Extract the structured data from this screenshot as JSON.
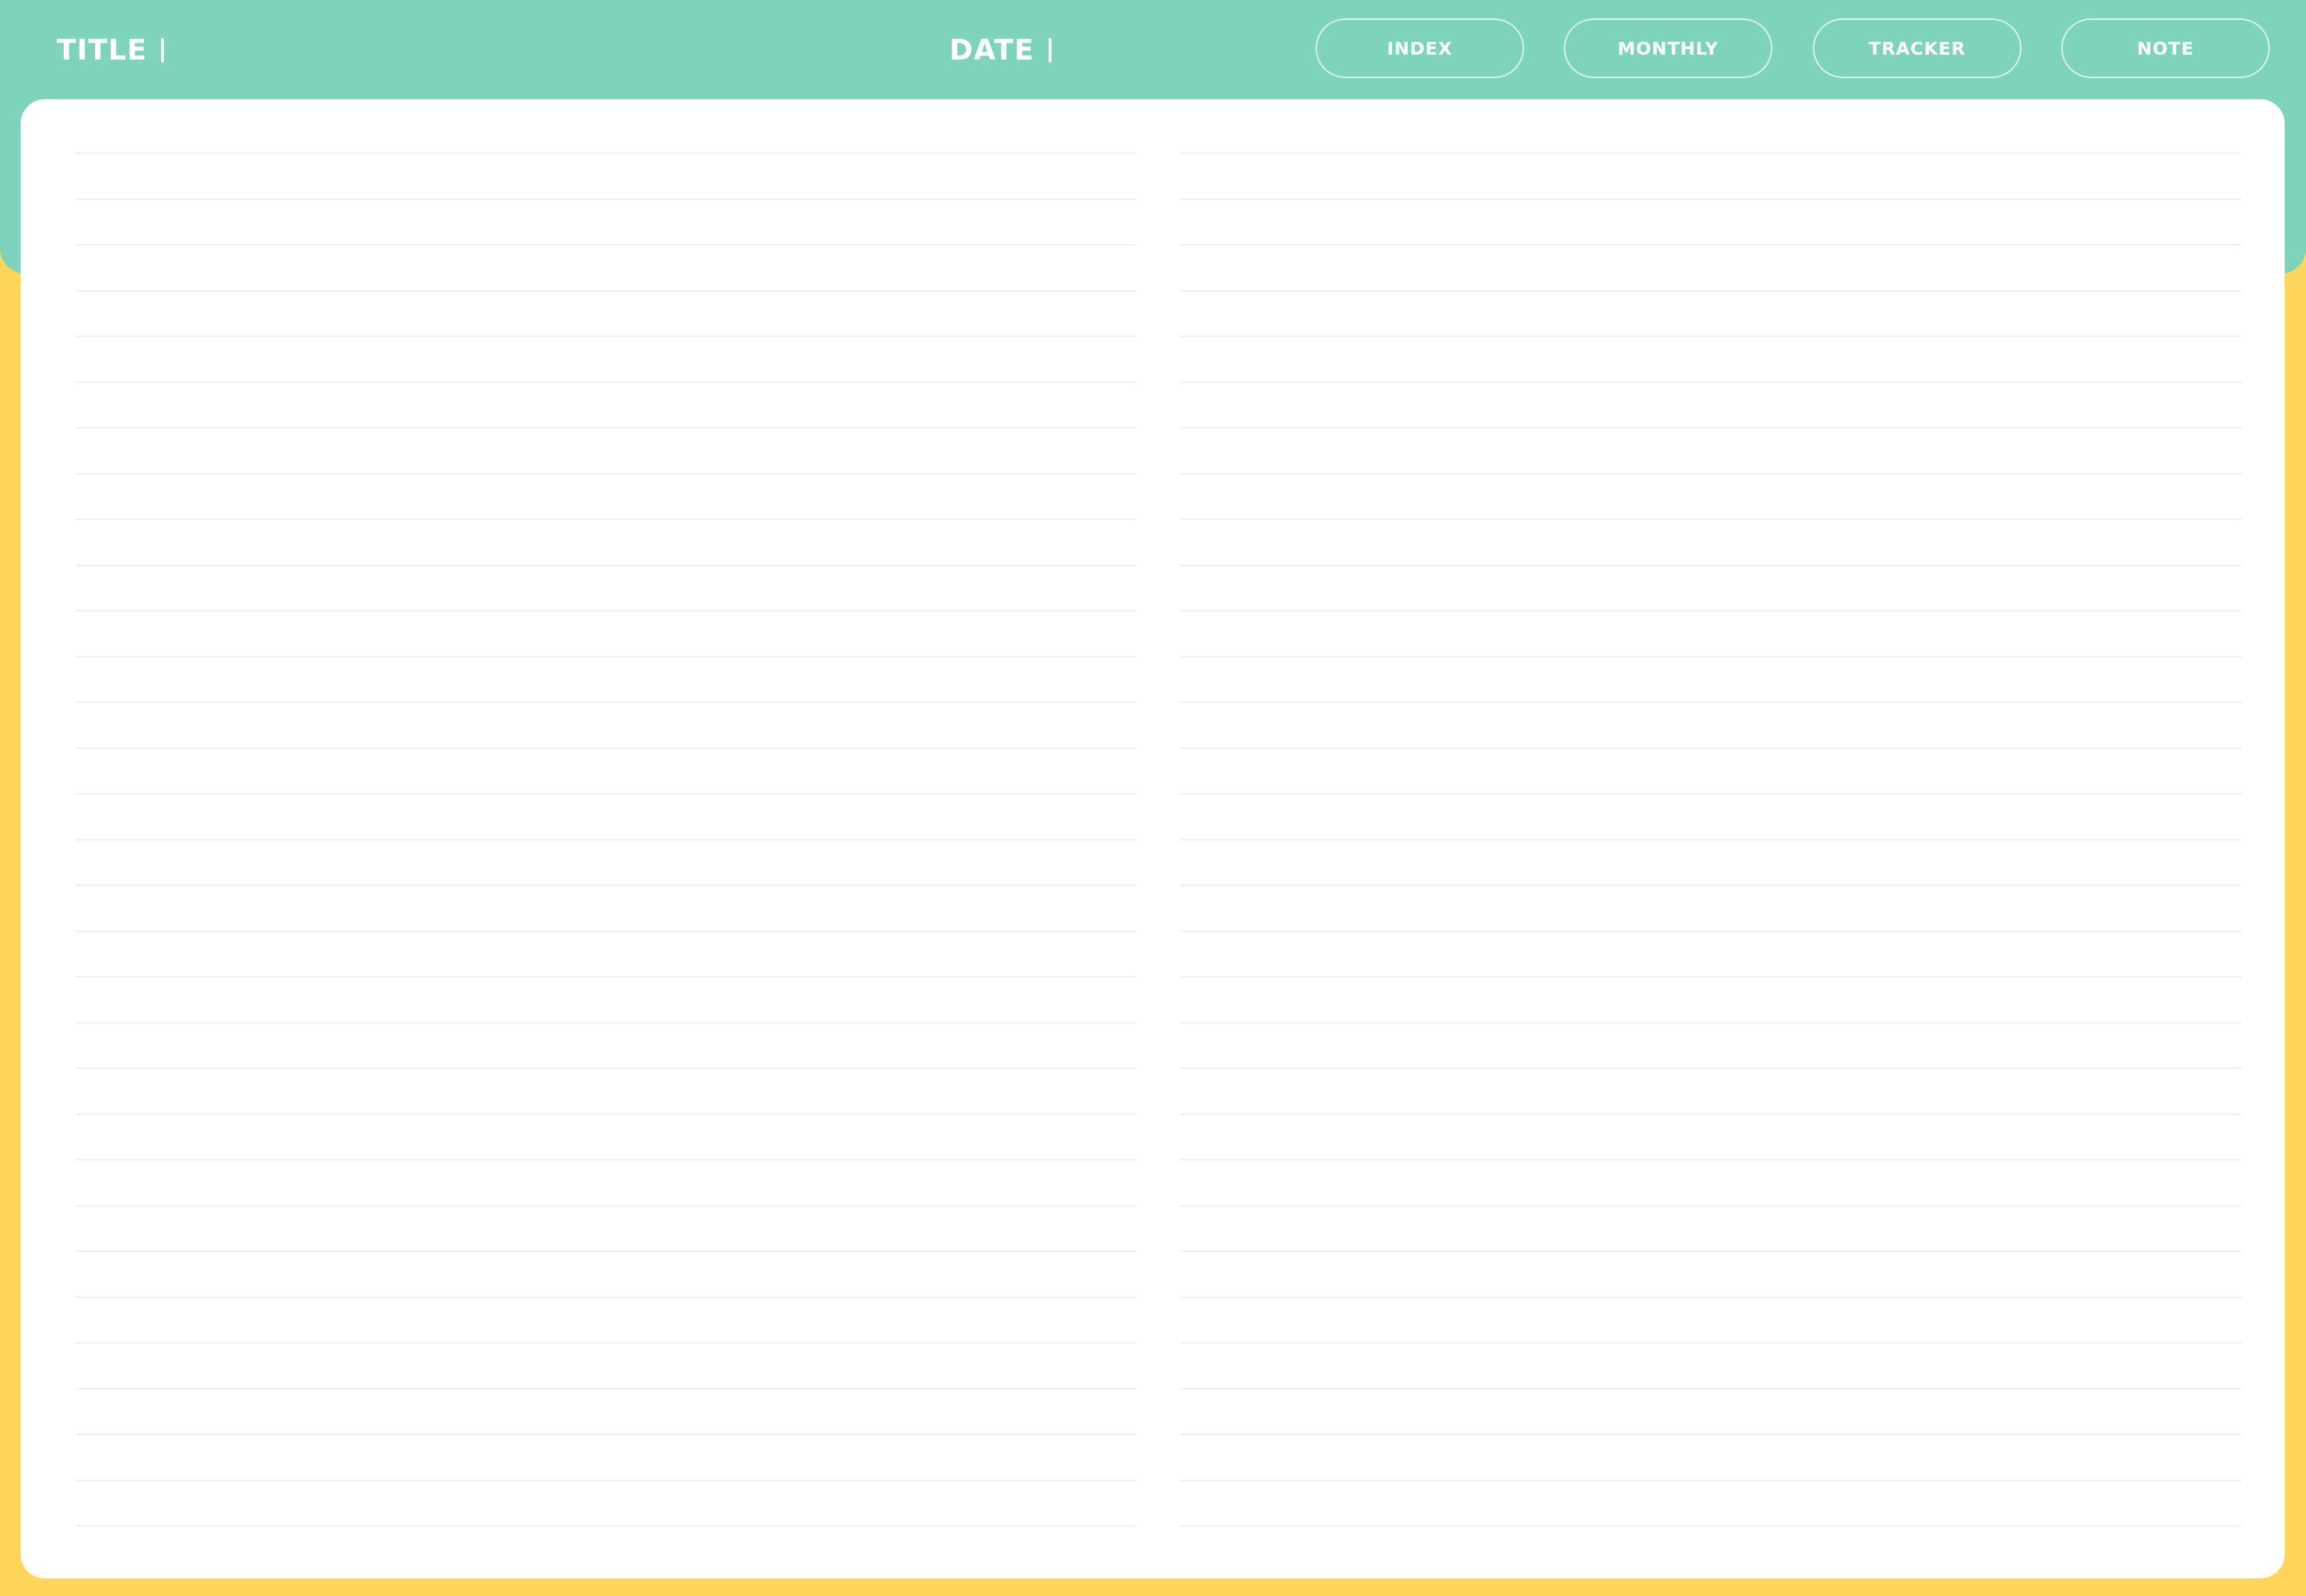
{
  "header": {
    "title_label": "TITLE",
    "date_label": "DATE",
    "nav": {
      "index_label": "INDEX",
      "monthly_label": "MONTHLY",
      "tracker_label": "TRACKER",
      "note_label": "NOTE"
    }
  },
  "sheet": {
    "columns": 2,
    "lines_per_column": 31
  },
  "colors": {
    "header": "#7ED3BC",
    "background": "#FFD65C",
    "sheet": "#FFFFFF",
    "rule": "#EDEEF0"
  }
}
